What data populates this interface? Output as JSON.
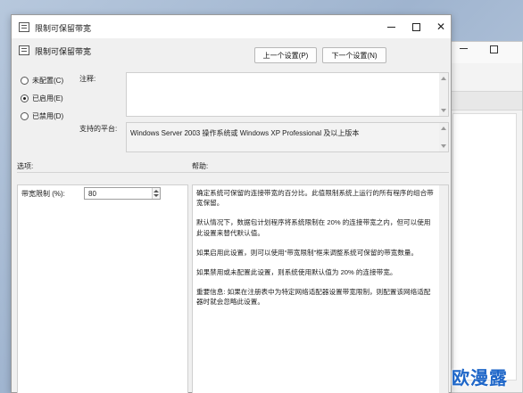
{
  "window": {
    "title": "限制可保留带宽",
    "subtitle": "限制可保留带宽"
  },
  "nav": {
    "prev_label": "上一个设置(P)",
    "next_label": "下一个设置(N)"
  },
  "state": {
    "options": [
      {
        "label": "未配置(C)",
        "checked": false
      },
      {
        "label": "已启用(E)",
        "checked": true
      },
      {
        "label": "已禁用(D)",
        "checked": false
      }
    ]
  },
  "comment": {
    "label": "注释:",
    "value": ""
  },
  "platform": {
    "label": "支持的平台:",
    "value": "Windows Server 2003 操作系统或 Windows XP Professional 及以上版本"
  },
  "options_section": {
    "label": "选项:",
    "bandwidth_label": "带宽限制 (%):",
    "bandwidth_value": "80"
  },
  "help_section": {
    "label": "帮助:",
    "paragraphs": [
      "确定系统可保留的连接带宽的百分比。此值限制系统上运行的所有程序的组合带宽保留。",
      "默认情况下，数据包计划程序将系统限制在 20% 的连接带宽之内，但可以使用此设置来替代默认值。",
      "如果启用此设置，则可以使用“带宽限制”框来调整系统可保留的带宽数量。",
      "如果禁用或未配置此设置，则系统使用默认值为 20% 的连接带宽。",
      "重要信息: 如果在注册表中为特定网络适配器设置带宽限制，则配置该网络适配器时就会忽略此设置。"
    ]
  },
  "watermark": "欧漫露"
}
